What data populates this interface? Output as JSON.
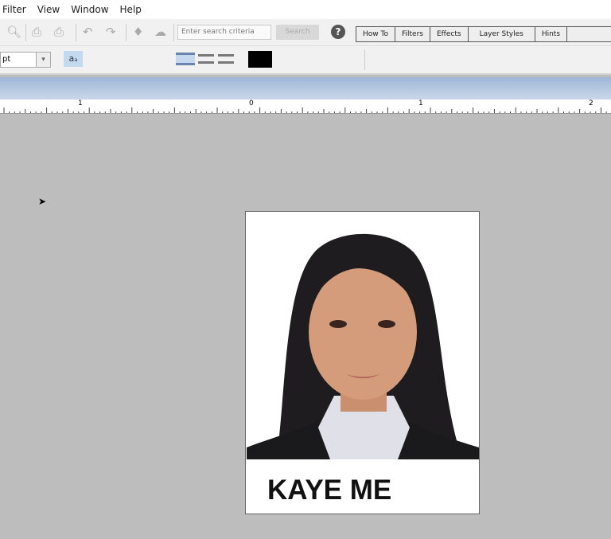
{
  "menu": [
    "Filter",
    "View",
    "Window",
    "Help"
  ],
  "search": {
    "placeholder": "Enter search criteria",
    "button": "Search"
  },
  "help_icon": "?",
  "tabs": [
    "How To",
    "Filters",
    "Effects",
    "Layer Styles",
    "Hints"
  ],
  "font_size_unit": "pt",
  "text_color": "#000000",
  "ruler_labels": [
    "1",
    "0",
    "1",
    "2"
  ],
  "card": {
    "name": "KAYE ME"
  }
}
